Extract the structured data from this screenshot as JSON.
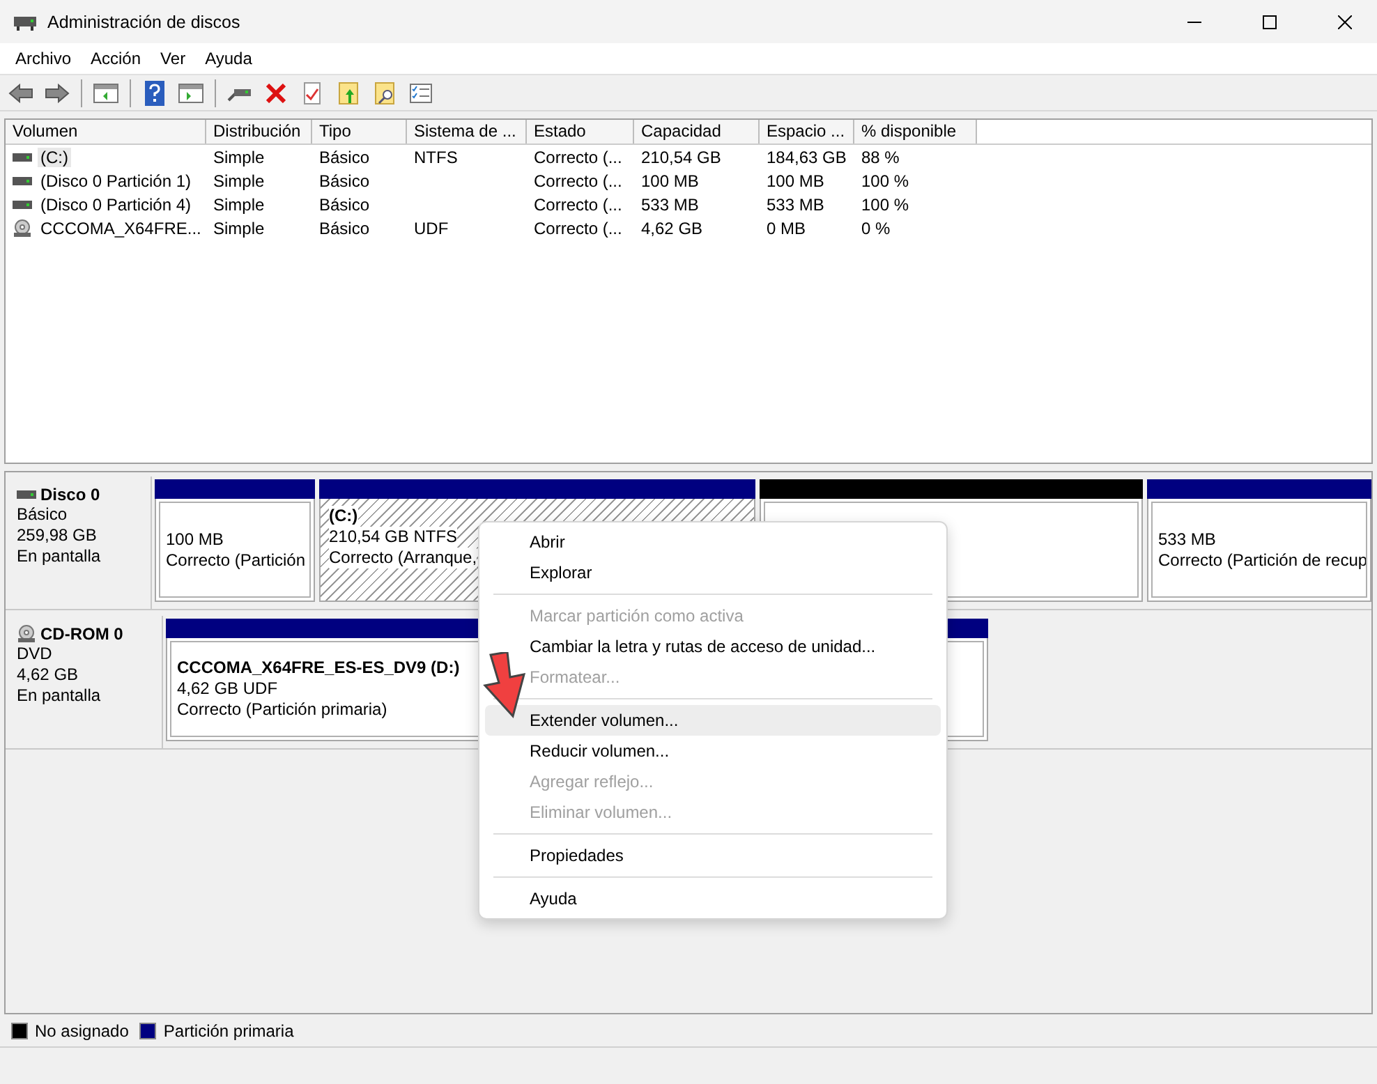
{
  "window": {
    "title": "Administración de discos"
  },
  "menu": [
    "Archivo",
    "Acción",
    "Ver",
    "Ayuda"
  ],
  "table": {
    "columns": [
      "Volumen",
      "Distribución",
      "Tipo",
      "Sistema de ...",
      "Estado",
      "Capacidad",
      "Espacio ...",
      "% disponible"
    ],
    "rows": [
      {
        "kind": "disk",
        "selected": true,
        "cells": [
          "(C:)",
          "Simple",
          "Básico",
          "NTFS",
          "Correcto (...",
          "210,54 GB",
          "184,63 GB",
          "88 %"
        ]
      },
      {
        "kind": "disk",
        "selected": false,
        "cells": [
          "(Disco 0 Partición 1)",
          "Simple",
          "Básico",
          "",
          "Correcto (...",
          "100 MB",
          "100 MB",
          "100 %"
        ]
      },
      {
        "kind": "disk",
        "selected": false,
        "cells": [
          "(Disco 0 Partición 4)",
          "Simple",
          "Básico",
          "",
          "Correcto (...",
          "533 MB",
          "533 MB",
          "100 %"
        ]
      },
      {
        "kind": "optical",
        "selected": false,
        "cells": [
          "CCCOMA_X64FRE...",
          "Simple",
          "Básico",
          "UDF",
          "Correcto (...",
          "4,62 GB",
          "0 MB",
          "0 %"
        ]
      }
    ]
  },
  "disks": [
    {
      "kind": "disk",
      "name": "Disco 0",
      "lines": [
        "Básico",
        "259,98 GB",
        "En pantalla"
      ],
      "partitions": [
        {
          "color": "#000080",
          "selected": false,
          "lines": [
            "100 MB",
            "Correcto (Partición"
          ]
        },
        {
          "color": "#000080",
          "selected": true,
          "title": "(C:)",
          "lines": [
            "210,54 GB NTFS",
            "Correcto (Arranque,"
          ]
        },
        {
          "color": "#000000",
          "selected": false
        },
        {
          "color": "#000080",
          "selected": false,
          "lines": [
            "533 MB",
            "Correcto (Partición de recup"
          ]
        }
      ]
    },
    {
      "kind": "optical",
      "name": "CD-ROM 0",
      "lines": [
        "DVD",
        "4,62 GB",
        "En pantalla"
      ],
      "partitions": [
        {
          "color": "#000080",
          "selected": false,
          "title": "CCCOMA_X64FRE_ES-ES_DV9  (D:)",
          "lines": [
            "4,62 GB UDF",
            "Correcto (Partición primaria)"
          ]
        }
      ]
    }
  ],
  "legend": [
    {
      "label": "No asignado",
      "color": "#000000"
    },
    {
      "label": "Partición primaria",
      "color": "#000080"
    }
  ],
  "context_menu": [
    {
      "kind": "item",
      "label": "Abrir",
      "disabled": false,
      "selected": false
    },
    {
      "kind": "item",
      "label": "Explorar",
      "disabled": false,
      "selected": false
    },
    {
      "kind": "separator"
    },
    {
      "kind": "item",
      "label": "Marcar partición como activa",
      "disabled": true,
      "selected": false
    },
    {
      "kind": "item",
      "label": "Cambiar la letra y rutas de acceso de unidad...",
      "disabled": false,
      "selected": false
    },
    {
      "kind": "item",
      "label": "Formatear...",
      "disabled": true,
      "selected": false
    },
    {
      "kind": "separator"
    },
    {
      "kind": "item",
      "label": "Extender volumen...",
      "disabled": false,
      "selected": true
    },
    {
      "kind": "item",
      "label": "Reducir volumen...",
      "disabled": false,
      "selected": false
    },
    {
      "kind": "item",
      "label": "Agregar reflejo...",
      "disabled": true,
      "selected": false
    },
    {
      "kind": "item",
      "label": "Eliminar volumen...",
      "disabled": true,
      "selected": false
    },
    {
      "kind": "separator"
    },
    {
      "kind": "item",
      "label": "Propiedades",
      "disabled": false,
      "selected": false
    },
    {
      "kind": "separator"
    },
    {
      "kind": "item",
      "label": "Ayuda",
      "disabled": false,
      "selected": false
    }
  ]
}
